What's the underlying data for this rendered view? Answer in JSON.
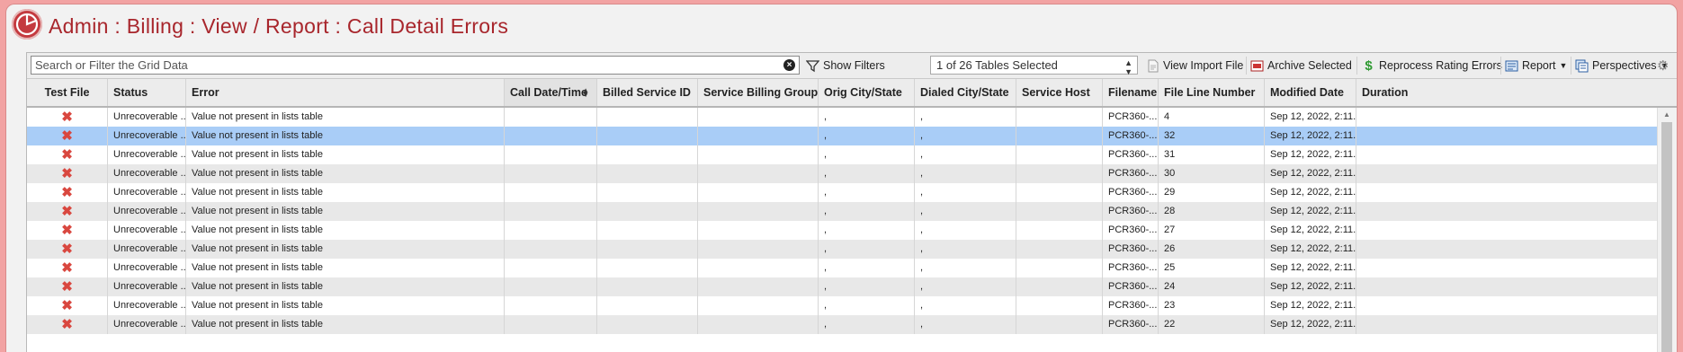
{
  "header": {
    "title": "Admin : Billing : View / Report : Call Detail Errors",
    "logo_icon": "pie-logo-icon"
  },
  "toolbar": {
    "search_placeholder": "Search or Filter the Grid Data",
    "show_filters": "Show Filters",
    "tables_selected": "1 of 26 Tables Selected",
    "view_import_file": "View Import File",
    "archive_selected": "Archive Selected",
    "reprocess_rating_errors": "Reprocess Rating Errors",
    "report": "Report",
    "perspectives": "Perspectives"
  },
  "columns": [
    "Test File",
    "Status",
    "Error",
    "Call Date/Time",
    "Billed Service ID",
    "Service Billing Group",
    "Orig City/State",
    "Dialed City/State",
    "Service Host",
    "Filename",
    "File Line Number",
    "Modified Date",
    "Duration"
  ],
  "sorted_column": "Call Date/Time",
  "rows": [
    {
      "status": "Unrecoverable ...",
      "error": "Value not present in lists table",
      "orig": ",",
      "dialed": ",",
      "filename": "PCR360-...",
      "line": "4",
      "modified": "Sep 12, 2022, 2:11..."
    },
    {
      "status": "Unrecoverable ...",
      "error": "Value not present in lists table",
      "orig": ",",
      "dialed": ",",
      "filename": "PCR360-...",
      "line": "32",
      "modified": "Sep 12, 2022, 2:11..."
    },
    {
      "status": "Unrecoverable ...",
      "error": "Value not present in lists table",
      "orig": ",",
      "dialed": ",",
      "filename": "PCR360-...",
      "line": "31",
      "modified": "Sep 12, 2022, 2:11..."
    },
    {
      "status": "Unrecoverable ...",
      "error": "Value not present in lists table",
      "orig": ",",
      "dialed": ",",
      "filename": "PCR360-...",
      "line": "30",
      "modified": "Sep 12, 2022, 2:11..."
    },
    {
      "status": "Unrecoverable ...",
      "error": "Value not present in lists table",
      "orig": ",",
      "dialed": ",",
      "filename": "PCR360-...",
      "line": "29",
      "modified": "Sep 12, 2022, 2:11..."
    },
    {
      "status": "Unrecoverable ...",
      "error": "Value not present in lists table",
      "orig": ",",
      "dialed": ",",
      "filename": "PCR360-...",
      "line": "28",
      "modified": "Sep 12, 2022, 2:11..."
    },
    {
      "status": "Unrecoverable ...",
      "error": "Value not present in lists table",
      "orig": ",",
      "dialed": ",",
      "filename": "PCR360-...",
      "line": "27",
      "modified": "Sep 12, 2022, 2:11..."
    },
    {
      "status": "Unrecoverable ...",
      "error": "Value not present in lists table",
      "orig": ",",
      "dialed": ",",
      "filename": "PCR360-...",
      "line": "26",
      "modified": "Sep 12, 2022, 2:11..."
    },
    {
      "status": "Unrecoverable ...",
      "error": "Value not present in lists table",
      "orig": ",",
      "dialed": ",",
      "filename": "PCR360-...",
      "line": "25",
      "modified": "Sep 12, 2022, 2:11..."
    },
    {
      "status": "Unrecoverable ...",
      "error": "Value not present in lists table",
      "orig": ",",
      "dialed": ",",
      "filename": "PCR360-...",
      "line": "24",
      "modified": "Sep 12, 2022, 2:11..."
    },
    {
      "status": "Unrecoverable ...",
      "error": "Value not present in lists table",
      "orig": ",",
      "dialed": ",",
      "filename": "PCR360-...",
      "line": "23",
      "modified": "Sep 12, 2022, 2:11..."
    },
    {
      "status": "Unrecoverable ...",
      "error": "Value not present in lists table",
      "orig": ",",
      "dialed": ",",
      "filename": "PCR360-...",
      "line": "22",
      "modified": "Sep 12, 2022, 2:11..."
    }
  ],
  "selected_row_index": 1,
  "colors": {
    "title": "#a8262c",
    "outer_background": "#f2a3a3",
    "selected_row": "#a9cdf7",
    "error_mark": "#d9473f"
  }
}
